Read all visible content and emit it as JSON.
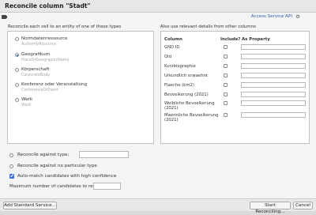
{
  "dialog": {
    "title": "Reconcile column \"Stadt\""
  },
  "service": {
    "link_label": "Access Service API",
    "settings_icon": "gear-icon"
  },
  "types": {
    "instruction": "Reconcile each cell to an entity of one of these types",
    "items": [
      {
        "name": "Normdatenressource",
        "id": "AuthorityResource",
        "selected": false
      },
      {
        "name": "Geografikum",
        "id": "PlaceOrGeographicName",
        "selected": true
      },
      {
        "name": "Körperschaft",
        "id": "CorporateBody",
        "selected": false
      },
      {
        "name": "Konferenz oder Veranstaltung",
        "id": "ConferenceOrEvent",
        "selected": false
      },
      {
        "name": "Werk",
        "id": "Work",
        "selected": false
      }
    ]
  },
  "columns": {
    "instruction": "Also use relevant details from other columns",
    "headers": {
      "column": "Column",
      "include": "Include?",
      "property": "As Property"
    },
    "rows": [
      {
        "name": "GND ID"
      },
      {
        "name": "Qid"
      },
      {
        "name": "Kurzbiographie"
      },
      {
        "name": "Urkundlich erwaehnt"
      },
      {
        "name": "Flaeche (km2)"
      },
      {
        "name": "Bevoelkerung (2021)"
      },
      {
        "name": "Weibliche Bevoelkerung (2021)"
      },
      {
        "name": "Maennliche Bevoelkerung (2021)"
      }
    ]
  },
  "options": {
    "against_type_label": "Reconcile against type:",
    "no_type_label": "Reconcile against no particular type",
    "auto_match_label": "Auto-match candidates with high confidence",
    "auto_match_checked": true,
    "max_candidates_label": "Maximum number of candidates to return"
  },
  "footer": {
    "add_service_label": "Add Standard Service...",
    "start_label": "Start Reconciling...",
    "cancel_label": "Cancel"
  }
}
